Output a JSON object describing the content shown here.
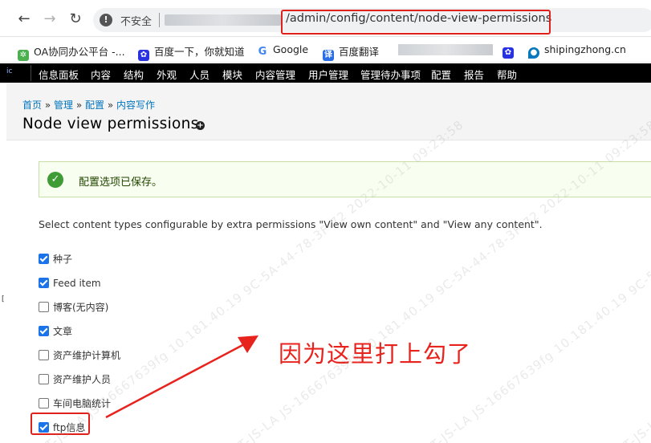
{
  "browser": {
    "insecure_label": "不安全",
    "url_path": "/admin/config/content/node-view-permissions"
  },
  "bookmarks": [
    {
      "label": "OA协同办公平台 -...",
      "icon": "flower-icon",
      "color": "#4caf50"
    },
    {
      "label": "百度一下，你就知道",
      "icon": "baidu-paw-icon",
      "color": "#2932e1"
    },
    {
      "label": "Google",
      "icon": "google-g-icon",
      "color": "#4285f4"
    },
    {
      "label": "百度翻译",
      "icon": "translate-icon",
      "color": "#2b6de5"
    },
    {
      "label": "",
      "icon": "baidu-paw-icon",
      "color": "#2932e1"
    },
    {
      "label": "shipingzhong.cn",
      "icon": "drupal-drop-icon",
      "color": "#0678be"
    }
  ],
  "toolbar": {
    "logo": "ic",
    "items": [
      "信息面板",
      "内容",
      "结构",
      "外观",
      "人员",
      "模块",
      "内容管理",
      "用户管理",
      "管理待办事项",
      "配置",
      "报告",
      "帮助"
    ]
  },
  "breadcrumb": {
    "items": [
      "首页",
      "管理",
      "配置",
      "内容写作"
    ],
    "separator": "»"
  },
  "page": {
    "title": "Node view permissions"
  },
  "status": {
    "message": "配置选项已保存。"
  },
  "description": "Select content types configurable by extra permissions \"View own content\" and \"View any content\".",
  "content_types": [
    {
      "label": "种子",
      "checked": true
    },
    {
      "label": "Feed item",
      "checked": true
    },
    {
      "label": "博客(无内容)",
      "checked": false
    },
    {
      "label": "文章",
      "checked": true
    },
    {
      "label": "资产维护计算机",
      "checked": false
    },
    {
      "label": "资产维护人员",
      "checked": false
    },
    {
      "label": "车间电脑统计",
      "checked": false
    },
    {
      "label": "ftp信息",
      "checked": true
    }
  ],
  "annotation": {
    "text": "因为这里打上勾了",
    "color": "#e8231d"
  },
  "watermark": "ICT-JS-LA JS-16667639fg 10.181.40.19 9C-5A-44-78-3F-72 2022-10-11 09:23:58"
}
